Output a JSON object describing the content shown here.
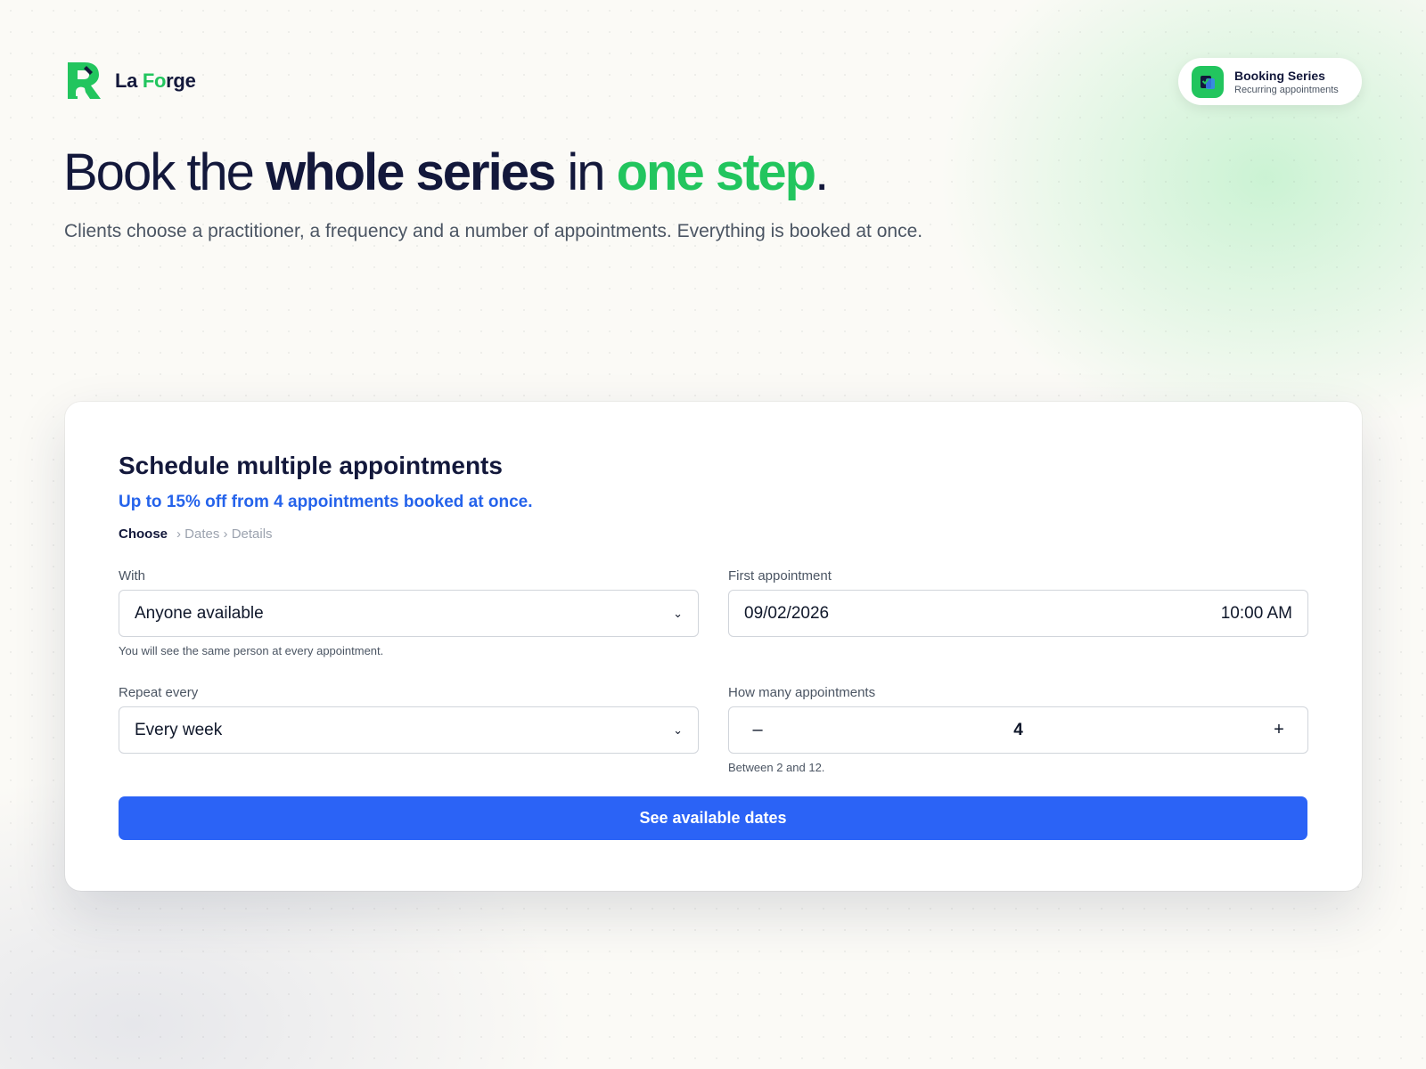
{
  "brand": {
    "name_part1": "La ",
    "name_part2": "Fo",
    "name_part3": "rge",
    "accent_color": "#22c55e",
    "logo_icon": "la-forge-logo"
  },
  "badge": {
    "icon": "calendar-check-icon",
    "title": "Booking Series",
    "subtitle": "Recurring appointments"
  },
  "hero": {
    "headline_1": "Book the ",
    "headline_2": "whole series",
    "headline_3": " in ",
    "headline_4": "one step",
    "headline_5": ".",
    "subtitle": "Clients choose a practitioner, a frequency and a number of appointments. Everything is booked at once."
  },
  "form": {
    "title": "Schedule multiple appointments",
    "promo": "Up to 15% off from 4 appointments booked at once.",
    "steps": {
      "active": "Choose",
      "rest": "› Dates › Details"
    },
    "with": {
      "label": "With",
      "value": "Anyone available",
      "help": "You will see the same person at every appointment."
    },
    "first_appointment": {
      "label": "First appointment",
      "date": "09/02/2026",
      "time": "10:00 AM"
    },
    "repeat": {
      "label": "Repeat every",
      "value": "Every week"
    },
    "count": {
      "label": "How many appointments",
      "minus": "–",
      "value": "4",
      "plus": "+",
      "help": "Between 2 and 12."
    },
    "cta_label": "See available dates",
    "cta_color": "#2b63f6",
    "promo_color": "#2563eb"
  }
}
